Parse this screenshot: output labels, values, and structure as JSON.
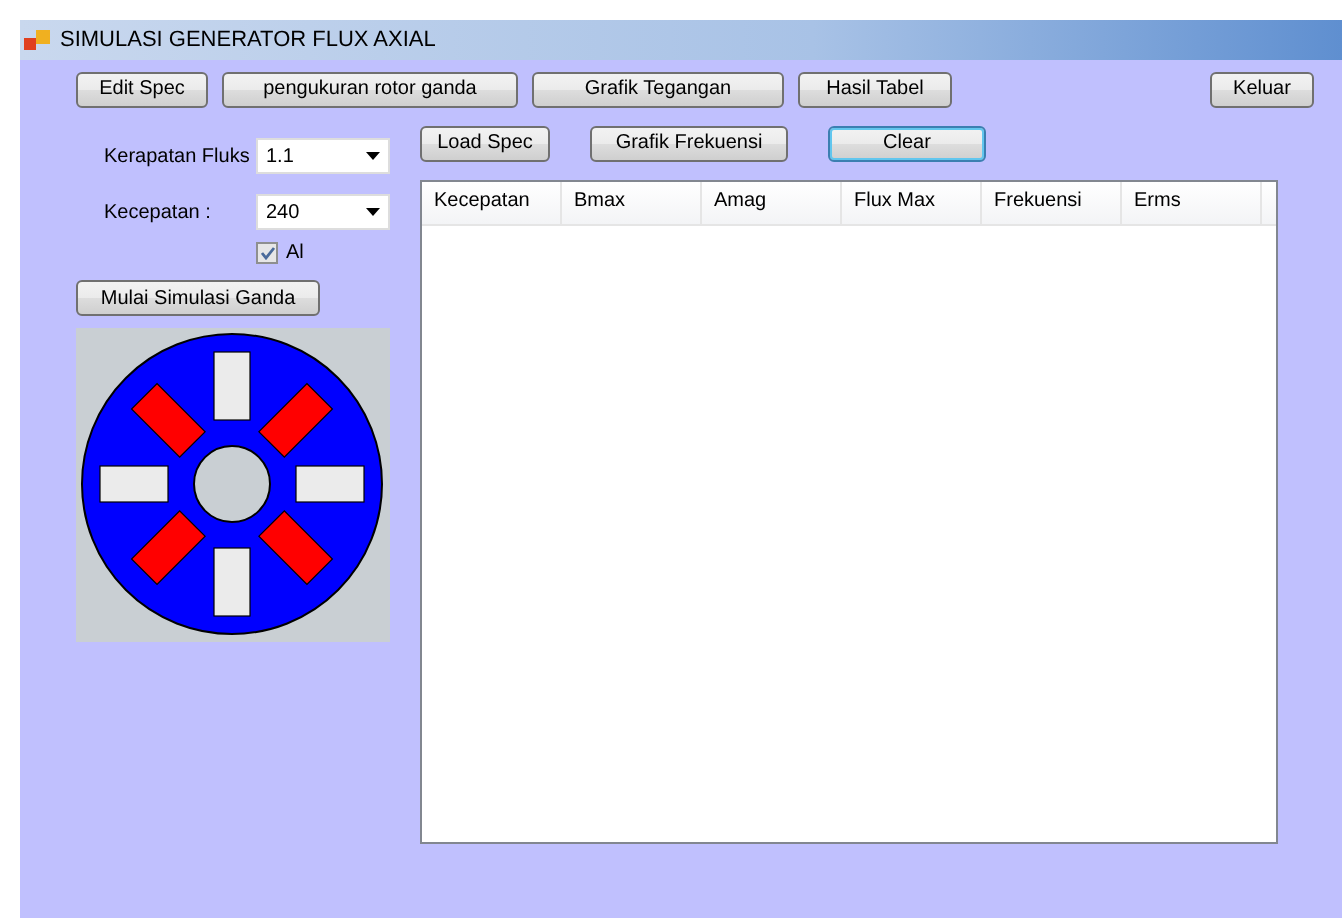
{
  "window": {
    "title": "SIMULASI GENERATOR FLUX AXIAL"
  },
  "toolbar": [
    {
      "label": "Edit Spec",
      "focused": false
    },
    {
      "label": "pengukuran rotor ganda",
      "focused": false
    },
    {
      "label": "Grafik Tegangan",
      "focused": false
    },
    {
      "label": "Hasil Tabel",
      "focused": false
    },
    {
      "label": "Keluar",
      "focused": false
    }
  ],
  "fields": [
    {
      "label": "Kerapatan Fluks",
      "value": "1.1"
    },
    {
      "label": "Kecepatan :",
      "value": "240"
    }
  ],
  "all_checkbox": {
    "label": "Al",
    "checked": true
  },
  "simulate_button": {
    "label": "Mulai Simulasi Ganda"
  },
  "actions": [
    {
      "label": "Load Spec",
      "focused": false
    },
    {
      "label": "Grafik Frekuensi",
      "focused": false
    },
    {
      "label": "Clear",
      "focused": true
    }
  ],
  "table": {
    "columns": [
      "Kecepatan",
      "Bmax",
      "Amag",
      "Flux Max",
      "Frekuensi",
      "Erms"
    ]
  }
}
